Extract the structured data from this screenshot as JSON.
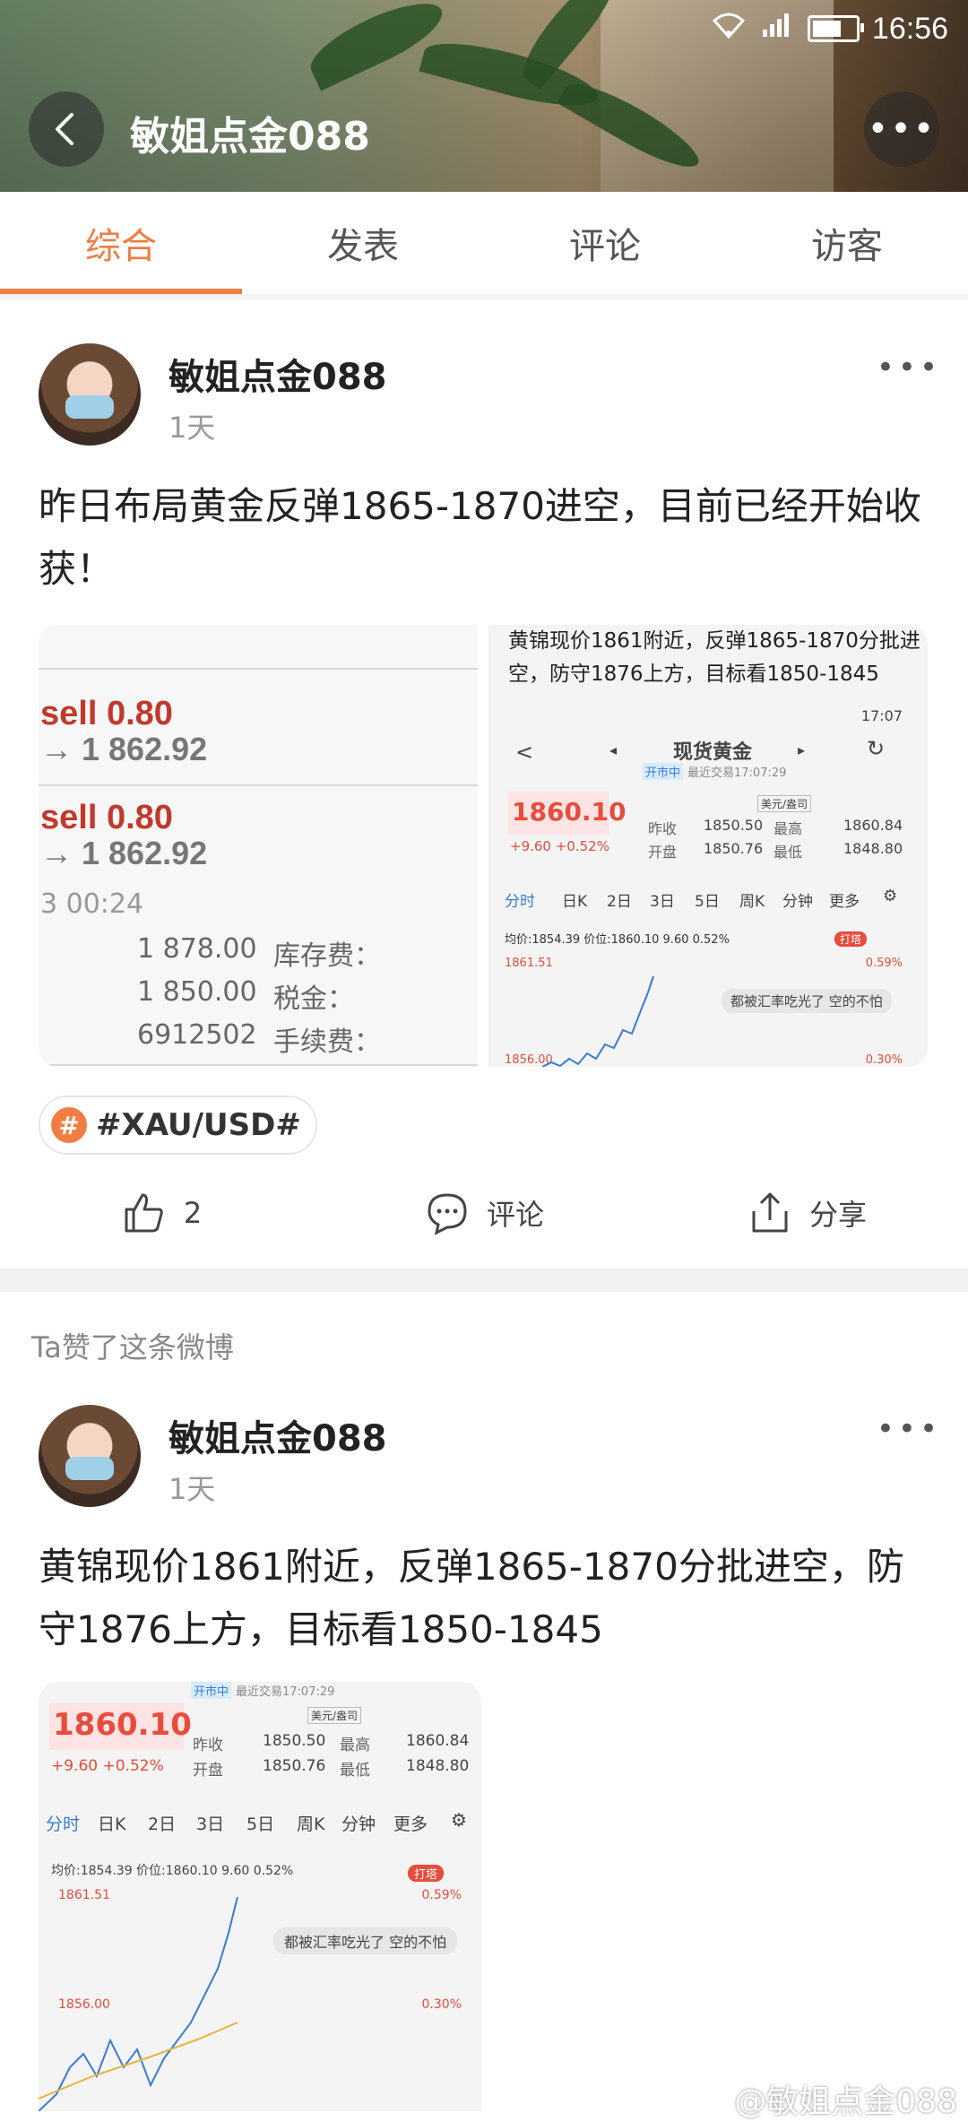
{
  "status": {
    "time": "16:56",
    "signal": "4G"
  },
  "header": {
    "title": "敏姐点金088"
  },
  "tabs": [
    {
      "label": "综合"
    },
    {
      "label": "发表"
    },
    {
      "label": "评论"
    },
    {
      "label": "访客"
    }
  ],
  "post1": {
    "user": "敏姐点金088",
    "time": "1天",
    "text": "昨日布局黄金反弹1865-1870进空，目前已经开始收获！",
    "left_image": {
      "sell1": "sell 0.80",
      "price1": "→ 1 862.92",
      "sell2": "sell 0.80",
      "price2": "→ 1 862.92",
      "time": "3 00:24",
      "v1": "1 878.00",
      "k1": "库存费：",
      "v2": "1 850.00",
      "k2": "税金：",
      "v3": "6912502",
      "k3": "手续费："
    },
    "right_image": {
      "caption": "黄锦现价1861附近，反弹1865-1870分批进空，防守1876上方，目标看1850-1845",
      "time": "17:07",
      "title": "现货黄金",
      "status": "开市中",
      "last_trade": "最近交易17:07:29",
      "unit": "美元/盎司",
      "price": "1860.10",
      "change": "+9.60 +0.52%",
      "prev_close_label": "昨收",
      "prev_close": "1850.50",
      "high_label": "最高",
      "high": "1860.84",
      "open_label": "开盘",
      "open": "1850.76",
      "low_label": "最低",
      "low": "1848.80",
      "periods": [
        "分时",
        "日K",
        "2日",
        "3日",
        "5日",
        "周K",
        "分钟",
        "更多"
      ],
      "avg": "均价:1854.39 价位:1860.10  9.60  0.52%",
      "y1": "1861.51",
      "p1": "0.59%",
      "y2": "1856.00",
      "p2": "0.30%",
      "comment": "都被汇率吃光了 空的不怕",
      "badge": "打塔"
    },
    "tag": "#XAU/USD#",
    "likes": "2",
    "comment_label": "评论",
    "share_label": "分享"
  },
  "liked_label": "Ta赞了这条微博",
  "post2": {
    "user": "敏姐点金088",
    "time": "1天",
    "text": "黄锦现价1861附近，反弹1865-1870分批进空，防守1876上方，目标看1850-1845",
    "image": {
      "status": "开市中",
      "last_trade": "最近交易17:07:29",
      "unit": "美元/盎司",
      "price": "1860.10",
      "change": "+9.60 +0.52%",
      "prev_close_label": "昨收",
      "prev_close": "1850.50",
      "high_label": "最高",
      "high": "1860.84",
      "open_label": "开盘",
      "open": "1850.76",
      "low_label": "最低",
      "low": "1848.80",
      "periods": [
        "分时",
        "日K",
        "2日",
        "3日",
        "5日",
        "周K",
        "分钟",
        "更多"
      ],
      "avg": "均价:1854.39 价位:1860.10  9.60  0.52%",
      "y1": "1861.51",
      "p1": "0.59%",
      "y2": "1856.00",
      "p2": "0.30%",
      "comment": "都被汇率吃光了 空的不怕",
      "badge": "打塔"
    }
  },
  "watermark": "@敏姐点金088"
}
